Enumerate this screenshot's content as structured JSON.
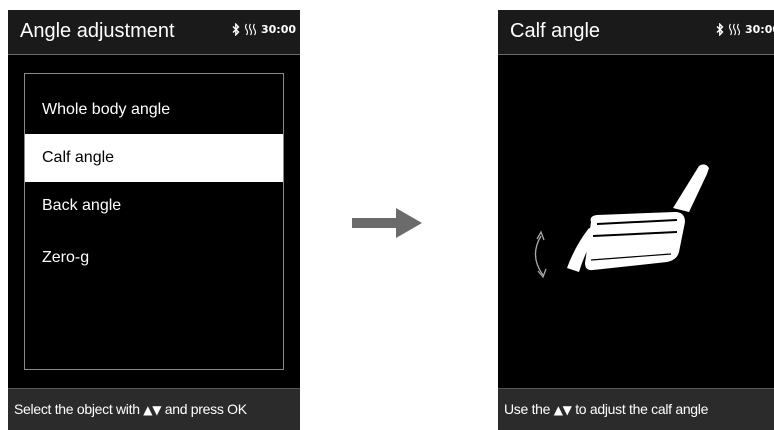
{
  "left_screen": {
    "title": "Angle adjustment",
    "status": {
      "time": "30:00",
      "icons": [
        "bluetooth-icon",
        "heat-icon"
      ]
    },
    "menu": {
      "items": [
        {
          "label": "Whole body angle",
          "selected": false
        },
        {
          "label": "Calf angle",
          "selected": true
        },
        {
          "label": "Back angle",
          "selected": false
        },
        {
          "label": "Zero-g",
          "selected": false
        }
      ]
    },
    "footer": {
      "before": "Select the object with ",
      "arrows": "▲▼",
      "after": " and press OK"
    }
  },
  "transition": {
    "icon": "arrow-right-icon"
  },
  "right_screen": {
    "title": "Calf angle",
    "status": {
      "time": "30:00",
      "icons": [
        "bluetooth-icon",
        "heat-icon"
      ]
    },
    "illustration": {
      "icon": "massage-chair-icon",
      "adjust_icon": "rotate-arrow-icon"
    },
    "footer": {
      "before": "Use the ",
      "arrows": "▲▼",
      "after": " to adjust the calf angle"
    }
  },
  "colors": {
    "screen_bg": "#000000",
    "header_bg": "#1a1a1a",
    "footer_bg": "#2b2b2b",
    "selected_bg": "#ffffff",
    "arrow": "#6b6b6b"
  }
}
